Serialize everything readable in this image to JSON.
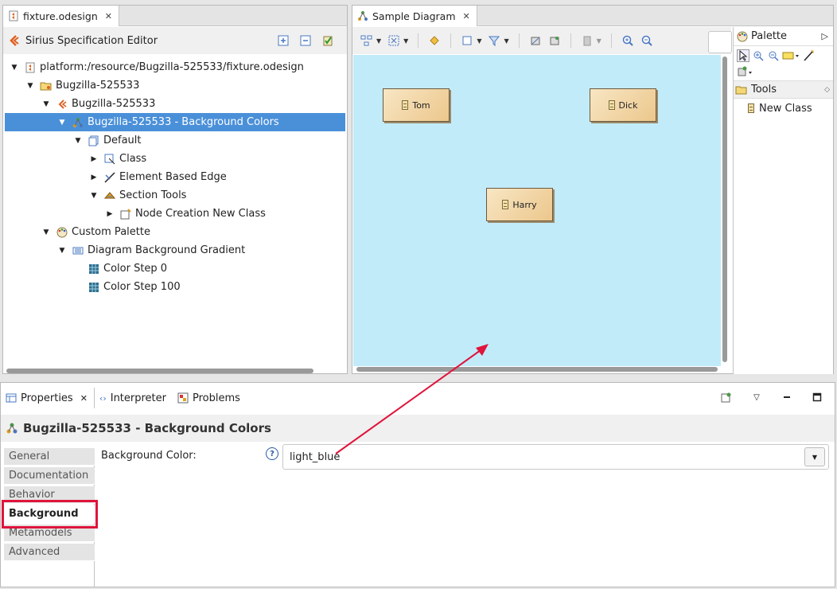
{
  "editor": {
    "tab_label": "fixture.odesign",
    "header_title": "Sirius Specification Editor",
    "tree": [
      {
        "label": "platform:/resource/Bugzilla-525533/fixture.odesign",
        "icon": "odesign-file-icon",
        "expanded": true
      },
      {
        "label": "Bugzilla-525533",
        "icon": "group-icon",
        "expanded": true
      },
      {
        "label": "Bugzilla-525533",
        "icon": "viewpoint-icon",
        "expanded": true
      },
      {
        "label": "Bugzilla-525533 - Background Colors",
        "icon": "diagram-description-icon",
        "expanded": true,
        "selected": true
      },
      {
        "label": "Default",
        "icon": "layer-icon",
        "expanded": true
      },
      {
        "label": "Class",
        "icon": "node-mapping-icon",
        "expanded": false
      },
      {
        "label": "Element Based Edge",
        "icon": "edge-mapping-icon",
        "expanded": false
      },
      {
        "label": "Section Tools",
        "icon": "section-icon",
        "expanded": true
      },
      {
        "label": "Node Creation New Class",
        "icon": "node-creation-icon",
        "expanded": false
      },
      {
        "label": "Custom Palette",
        "icon": "palette-icon",
        "expanded": true
      },
      {
        "label": "Diagram Background Gradient",
        "icon": "gradient-icon",
        "expanded": true
      },
      {
        "label": "Color Step 0",
        "icon": "color-step-icon",
        "leaf": true
      },
      {
        "label": "Color Step 100",
        "icon": "color-step-icon",
        "leaf": true
      }
    ]
  },
  "diagram": {
    "tab_label": "Sample Diagram",
    "background_color": "#c2ebfa",
    "nodes": [
      {
        "label": "Tom"
      },
      {
        "label": "Dick"
      },
      {
        "label": "Harry"
      }
    ],
    "palette": {
      "title": "Palette",
      "drawer": "Tools",
      "entries": [
        "New Class"
      ]
    }
  },
  "properties": {
    "tabs": [
      "Properties",
      "Interpreter",
      "Problems"
    ],
    "title": "Bugzilla-525533 - Background Colors",
    "side_tabs": [
      "General",
      "Documentation",
      "Behavior",
      "Background",
      "Metamodels",
      "Advanced"
    ],
    "active_side_tab": "Background",
    "field_label": "Background Color:",
    "field_value": "light_blue",
    "help_glyph": "?"
  },
  "colors": {
    "highlight": "#e0143c",
    "selection": "#4a90d9",
    "node_fill": "#ecc78c"
  }
}
